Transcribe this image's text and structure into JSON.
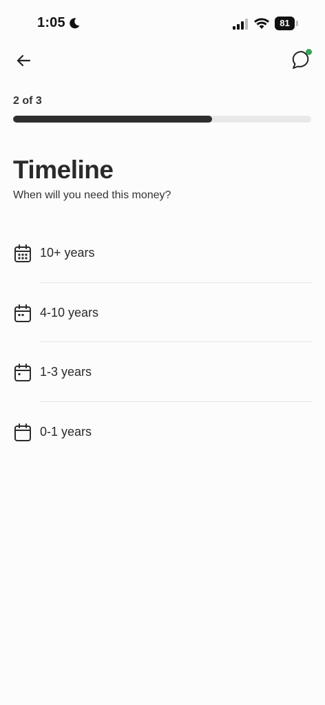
{
  "status_bar": {
    "time": "1:05",
    "battery": "81"
  },
  "nav": {
    "back_icon": "arrow-left-icon",
    "chat_icon": "chat-bubble-icon",
    "notification_color": "#3aa35a"
  },
  "progress": {
    "label": "2 of 3",
    "current_step": 2,
    "total_steps": 3,
    "fill_fraction": 0.667
  },
  "header": {
    "title": "Timeline",
    "subtitle": "When will you need this money?"
  },
  "options": [
    {
      "label": "10+ years",
      "icon": "calendar-many-dots-icon"
    },
    {
      "label": "4-10 years",
      "icon": "calendar-two-dots-icon"
    },
    {
      "label": "1-3 years",
      "icon": "calendar-one-dot-icon"
    },
    {
      "label": "0-1 years",
      "icon": "calendar-empty-icon"
    }
  ],
  "colors": {
    "background": "#fcfcfc",
    "progress_fill": "#2e2e2e",
    "progress_track": "#e9e9e9",
    "text": "#2a2a2a"
  }
}
